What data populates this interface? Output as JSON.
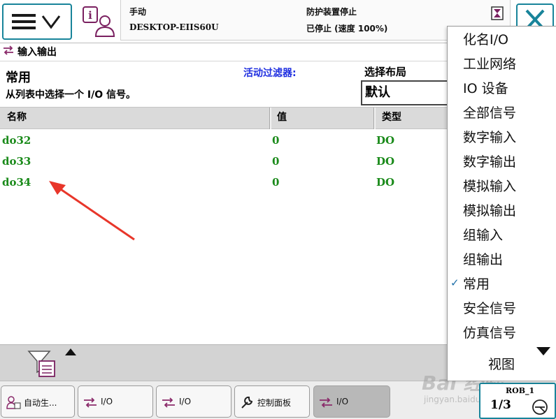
{
  "topbar": {
    "mode": "手动",
    "system": "DESKTOP-EIIS60U",
    "status1": "防护装置停止",
    "status2": "已停止 (速度 100%)"
  },
  "window": {
    "title": "输入输出"
  },
  "filter": {
    "category": "常用",
    "instruction": "从列表中选择一个 I/O 信号。",
    "active_filter_label": "活动过滤器:",
    "layout_label": "选择布局",
    "layout_value": "默认"
  },
  "table": {
    "columns": [
      "名称",
      "值",
      "类型"
    ],
    "rows": [
      {
        "name": "do32",
        "value": "0",
        "type": "DO"
      },
      {
        "name": "do33",
        "value": "0",
        "type": "DO"
      },
      {
        "name": "do34",
        "value": "0",
        "type": "DO"
      }
    ]
  },
  "dropdown": {
    "items": [
      {
        "label": "化名I/O",
        "checked": false
      },
      {
        "label": "工业网络",
        "checked": false
      },
      {
        "label": "IO 设备",
        "checked": false
      },
      {
        "label": "全部信号",
        "checked": false
      },
      {
        "label": "数字输入",
        "checked": false
      },
      {
        "label": "数字输出",
        "checked": false
      },
      {
        "label": "模拟输入",
        "checked": false
      },
      {
        "label": "模拟输出",
        "checked": false
      },
      {
        "label": "组输入",
        "checked": false
      },
      {
        "label": "组输出",
        "checked": false
      },
      {
        "label": "常用",
        "checked": true
      },
      {
        "label": "安全信号",
        "checked": false
      },
      {
        "label": "仿真信号",
        "checked": false
      }
    ],
    "view_label": "视图",
    "check_mark": "✓"
  },
  "taskbar": {
    "tasks": [
      {
        "label": "自动生...",
        "icon": "auto-gen-icon",
        "active": false
      },
      {
        "label": "I/O",
        "icon": "io-arrows-icon",
        "active": false
      },
      {
        "label": "I/O",
        "icon": "io-arrows-icon",
        "active": false
      },
      {
        "label": "控制面板",
        "icon": "wrench-icon",
        "active": false
      },
      {
        "label": "I/O",
        "icon": "io-arrows-icon",
        "active": true
      }
    ],
    "rob_label": "ROB_1",
    "speed_fraction": "1/3"
  },
  "watermark": {
    "text": "Bai 经验",
    "sub": "jingyan.baidu.com"
  },
  "colors": {
    "accent": "#18849a",
    "signal_text": "#1a8a1a",
    "filter_label": "#1f2fe0",
    "io_icon": "#8a2a6a",
    "arrow": "#e8362a"
  }
}
